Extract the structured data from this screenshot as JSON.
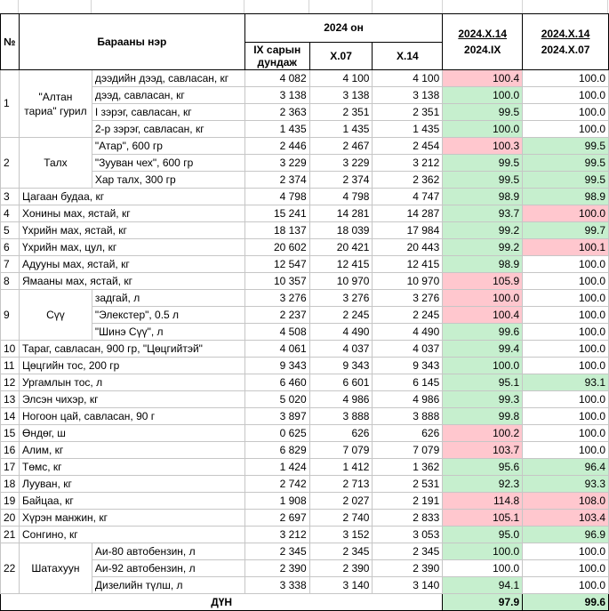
{
  "header": {
    "no": "№",
    "name": "Барааны нэр",
    "year_group": "2024 он",
    "col_ix": "IX сарын дундаж",
    "col_x07": "X.07",
    "col_x14": "X.14",
    "ratio1_top": "2024.X.14",
    "ratio1_bottom": "2024.IX",
    "ratio2_top": "2024.X.14",
    "ratio2_bottom": "2024.X.07"
  },
  "groups": {
    "g1_no": "1",
    "g1_name": "\"Алтан тариа\" гурил",
    "g2_no": "2",
    "g2_name": "Талх",
    "g9_no": "9",
    "g9_name": "Сүү",
    "g22_no": "22",
    "g22_name": "Шатахуун"
  },
  "rows": [
    {
      "no": "",
      "name": "дээдийн дээд, савласан, кг",
      "ix": "4 082",
      "x07": "4 100",
      "x14": "4 100",
      "r1": "100.4",
      "r2": "100.0",
      "c1": "pink",
      "c2": ""
    },
    {
      "no": "",
      "name": "дээд, савласан, кг",
      "ix": "3 138",
      "x07": "3 138",
      "x14": "3 138",
      "r1": "100.0",
      "r2": "100.0",
      "c1": "green",
      "c2": ""
    },
    {
      "no": "",
      "name": "I зэрэг, савласан, кг",
      "ix": "2 363",
      "x07": "2 351",
      "x14": "2 351",
      "r1": "99.5",
      "r2": "100.0",
      "c1": "green",
      "c2": ""
    },
    {
      "no": "",
      "name": "2-р зэрэг, савласан, кг",
      "ix": "1 435",
      "x07": "1 435",
      "x14": "1 435",
      "r1": "100.0",
      "r2": "100.0",
      "c1": "green",
      "c2": ""
    },
    {
      "no": "",
      "name": "\"Атар\", 600 гр",
      "ix": "2 446",
      "x07": "2 467",
      "x14": "2 454",
      "r1": "100.3",
      "r2": "99.5",
      "c1": "pink",
      "c2": "green"
    },
    {
      "no": "",
      "name": "\"Зууван чех\", 600 гр",
      "ix": "3 229",
      "x07": "3 229",
      "x14": "3 212",
      "r1": "99.5",
      "r2": "99.5",
      "c1": "green",
      "c2": "green"
    },
    {
      "no": "",
      "name": "Хар талх, 300 гр",
      "ix": "2 374",
      "x07": "2 374",
      "x14": "2 362",
      "r1": "99.5",
      "r2": "99.5",
      "c1": "green",
      "c2": "green"
    },
    {
      "no": "3",
      "name": "Цагаан будаа, кг",
      "ix": "4 798",
      "x07": "4 798",
      "x14": "4 747",
      "r1": "98.9",
      "r2": "98.9",
      "c1": "green",
      "c2": "green"
    },
    {
      "no": "4",
      "name": "Хонины мах, ястай, кг",
      "ix": "15 241",
      "x07": "14 281",
      "x14": "14 287",
      "r1": "93.7",
      "r2": "100.0",
      "c1": "green",
      "c2": "pink"
    },
    {
      "no": "5",
      "name": "Үхрийн мах, ястай, кг",
      "ix": "18 137",
      "x07": "18 039",
      "x14": "17 984",
      "r1": "99.2",
      "r2": "99.7",
      "c1": "green",
      "c2": "green"
    },
    {
      "no": "6",
      "name": "Үхрийн мах, цул, кг",
      "ix": "20 602",
      "x07": "20 421",
      "x14": "20 443",
      "r1": "99.2",
      "r2": "100.1",
      "c1": "green",
      "c2": "pink"
    },
    {
      "no": "7",
      "name": "Адууны мах, ястай, кг",
      "ix": "12 547",
      "x07": "12 415",
      "x14": "12 415",
      "r1": "98.9",
      "r2": "100.0",
      "c1": "green",
      "c2": ""
    },
    {
      "no": "8",
      "name": "Ямааны мах, ястай, кг",
      "ix": "10 357",
      "x07": "10 970",
      "x14": "10 970",
      "r1": "105.9",
      "r2": "100.0",
      "c1": "pink",
      "c2": ""
    },
    {
      "no": "",
      "name": "задгай, л",
      "ix": "3 276",
      "x07": "3 276",
      "x14": "3 276",
      "r1": "100.0",
      "r2": "100.0",
      "c1": "pink",
      "c2": ""
    },
    {
      "no": "",
      "name": "\"Элекстер\", 0.5 л",
      "ix": "2 237",
      "x07": "2 245",
      "x14": "2 245",
      "r1": "100.4",
      "r2": "100.0",
      "c1": "pink",
      "c2": ""
    },
    {
      "no": "",
      "name": "\"Шинэ Сүү\", л",
      "ix": "4 508",
      "x07": "4 490",
      "x14": "4 490",
      "r1": "99.6",
      "r2": "100.0",
      "c1": "green",
      "c2": ""
    },
    {
      "no": "10",
      "name": "Тараг, савласан, 900 гр, \"Цөцгийтэй\"",
      "ix": "4 061",
      "x07": "4 037",
      "x14": "4 037",
      "r1": "99.4",
      "r2": "100.0",
      "c1": "green",
      "c2": ""
    },
    {
      "no": "11",
      "name": "Цөцгийн тос, 200 гр",
      "ix": "9 343",
      "x07": "9 343",
      "x14": "9 343",
      "r1": "100.0",
      "r2": "100.0",
      "c1": "green",
      "c2": ""
    },
    {
      "no": "12",
      "name": "Ургамлын тос, л",
      "ix": "6 460",
      "x07": "6 601",
      "x14": "6 145",
      "r1": "95.1",
      "r2": "93.1",
      "c1": "green",
      "c2": "green"
    },
    {
      "no": "13",
      "name": "Элсэн чихэр, кг",
      "ix": "5 020",
      "x07": "4 986",
      "x14": "4 986",
      "r1": "99.3",
      "r2": "100.0",
      "c1": "green",
      "c2": ""
    },
    {
      "no": "14",
      "name": "Ногоон цай, савласан, 90 г",
      "ix": "3 897",
      "x07": "3 888",
      "x14": "3 888",
      "r1": "99.8",
      "r2": "100.0",
      "c1": "green",
      "c2": ""
    },
    {
      "no": "15",
      "name": "Өндөг, ш",
      "ix": "0 625",
      "x07": "626",
      "x14": "626",
      "r1": "100.2",
      "r2": "100.0",
      "c1": "pink",
      "c2": ""
    },
    {
      "no": "16",
      "name": "Алим, кг",
      "ix": "6 829",
      "x07": "7 079",
      "x14": "7 079",
      "r1": "103.7",
      "r2": "100.0",
      "c1": "pink",
      "c2": ""
    },
    {
      "no": "17",
      "name": "Төмс, кг",
      "ix": "1 424",
      "x07": "1 412",
      "x14": "1 362",
      "r1": "95.6",
      "r2": "96.4",
      "c1": "green",
      "c2": "green"
    },
    {
      "no": "18",
      "name": "Лууван, кг",
      "ix": "2 742",
      "x07": "2 713",
      "x14": "2 531",
      "r1": "92.3",
      "r2": "93.3",
      "c1": "green",
      "c2": "green"
    },
    {
      "no": "19",
      "name": "Байцаа, кг",
      "ix": "1 908",
      "x07": "2 027",
      "x14": "2 191",
      "r1": "114.8",
      "r2": "108.0",
      "c1": "pink",
      "c2": "pink"
    },
    {
      "no": "20",
      "name": "Хүрэн манжин, кг",
      "ix": "2 697",
      "x07": "2 740",
      "x14": "2 833",
      "r1": "105.1",
      "r2": "103.4",
      "c1": "pink",
      "c2": "pink"
    },
    {
      "no": "21",
      "name": "Сонгино, кг",
      "ix": "3 212",
      "x07": "3 152",
      "x14": "3 053",
      "r1": "95.0",
      "r2": "96.9",
      "c1": "green",
      "c2": "green"
    },
    {
      "no": "",
      "name": "Аи-80 автобензин, л",
      "ix": "2 345",
      "x07": "2 345",
      "x14": "2 345",
      "r1": "100.0",
      "r2": "100.0",
      "c1": "green",
      "c2": ""
    },
    {
      "no": "",
      "name": "Аи-92 автобензин, л",
      "ix": "2 390",
      "x07": "2 390",
      "x14": "2 390",
      "r1": "100.0",
      "r2": "100.0",
      "c1": "",
      "c2": ""
    },
    {
      "no": "",
      "name": "Дизелийн түлш, л",
      "ix": "3 338",
      "x07": "3 140",
      "x14": "3 140",
      "r1": "94.1",
      "r2": "100.0",
      "c1": "green",
      "c2": ""
    }
  ],
  "total": {
    "label": "ДҮН",
    "r1": "97.9",
    "r2": "99.6"
  },
  "colors": {
    "increase": "#ffc7ce",
    "decrease": "#c6efce",
    "border": "#c6c6c6"
  }
}
